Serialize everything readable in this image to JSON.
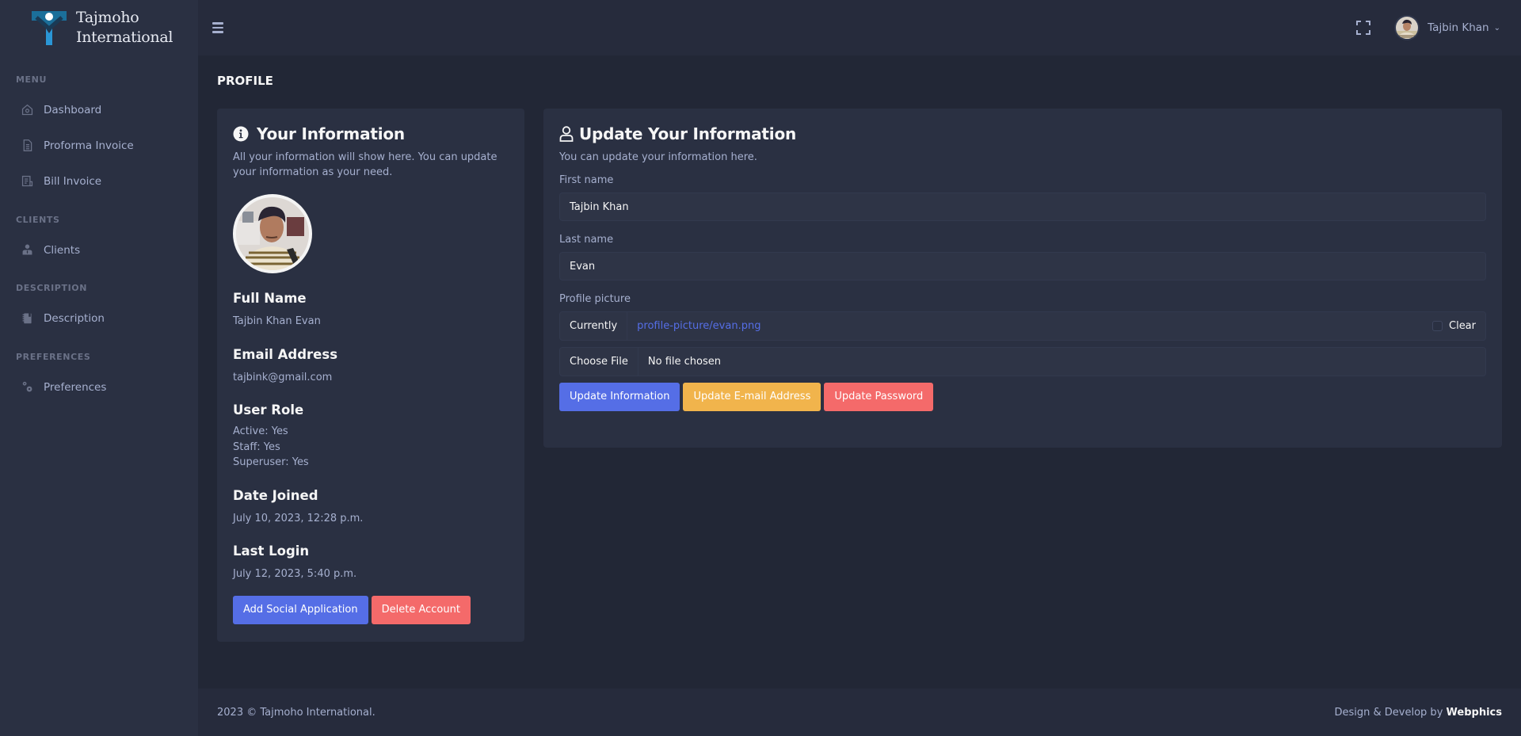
{
  "brand": {
    "line1": "Tajmoho",
    "line2": "International"
  },
  "sidebar": {
    "sections": [
      {
        "title": "Menu",
        "items": [
          {
            "label": "Dashboard",
            "icon": "home-icon"
          },
          {
            "label": "Proforma Invoice",
            "icon": "file-icon"
          },
          {
            "label": "Bill Invoice",
            "icon": "receipt-icon"
          }
        ]
      },
      {
        "title": "Clients",
        "items": [
          {
            "label": "Clients",
            "icon": "user-tie-icon"
          }
        ]
      },
      {
        "title": "Description",
        "items": [
          {
            "label": "Description",
            "icon": "notebook-icon"
          }
        ]
      },
      {
        "title": "Preferences",
        "items": [
          {
            "label": "Preferences",
            "icon": "gears-icon"
          }
        ]
      }
    ]
  },
  "topbar": {
    "user_name": "Tajbin Khan",
    "caret": "⌄"
  },
  "page": {
    "title": "PROFILE"
  },
  "info_card": {
    "title": "Your Information",
    "description": "All your information will show here. You can update your information as your need.",
    "full_name_label": "Full Name",
    "full_name": "Tajbin Khan Evan",
    "email_label": "Email Address",
    "email": "tajbink@gmail.com",
    "role_label": "User Role",
    "roles": [
      "Active: Yes",
      "Staff: Yes",
      "Superuser: Yes"
    ],
    "joined_label": "Date Joined",
    "joined": "July 10, 2023, 12:28 p.m.",
    "last_login_label": "Last Login",
    "last_login": "July 12, 2023, 5:40 p.m.",
    "add_social_button": "Add Social Application",
    "delete_button": "Delete Account"
  },
  "update_card": {
    "title": "Update Your Information",
    "description": "You can update your information here.",
    "first_name_label": "First name",
    "first_name_value": "Tajbin Khan",
    "last_name_label": "Last name",
    "last_name_value": "Evan",
    "picture_label": "Profile picture",
    "currently_label": "Currently",
    "current_file": "profile-picture/evan.png",
    "clear_label": "Clear",
    "choose_file_label": "Choose File",
    "no_file_text": "No file chosen",
    "update_info_button": "Update Information",
    "update_email_button": "Update E-mail Address",
    "update_password_button": "Update Password"
  },
  "footer": {
    "copyright": "2023 © Tajmoho International.",
    "credit_prefix": "Design & Develop by",
    "credit_name": "Webphics"
  },
  "colors": {
    "primary": "#556ee6",
    "warning": "#f1b44c",
    "danger": "#f46a6a",
    "sidebar": "#2a3042",
    "body": "#222736"
  }
}
